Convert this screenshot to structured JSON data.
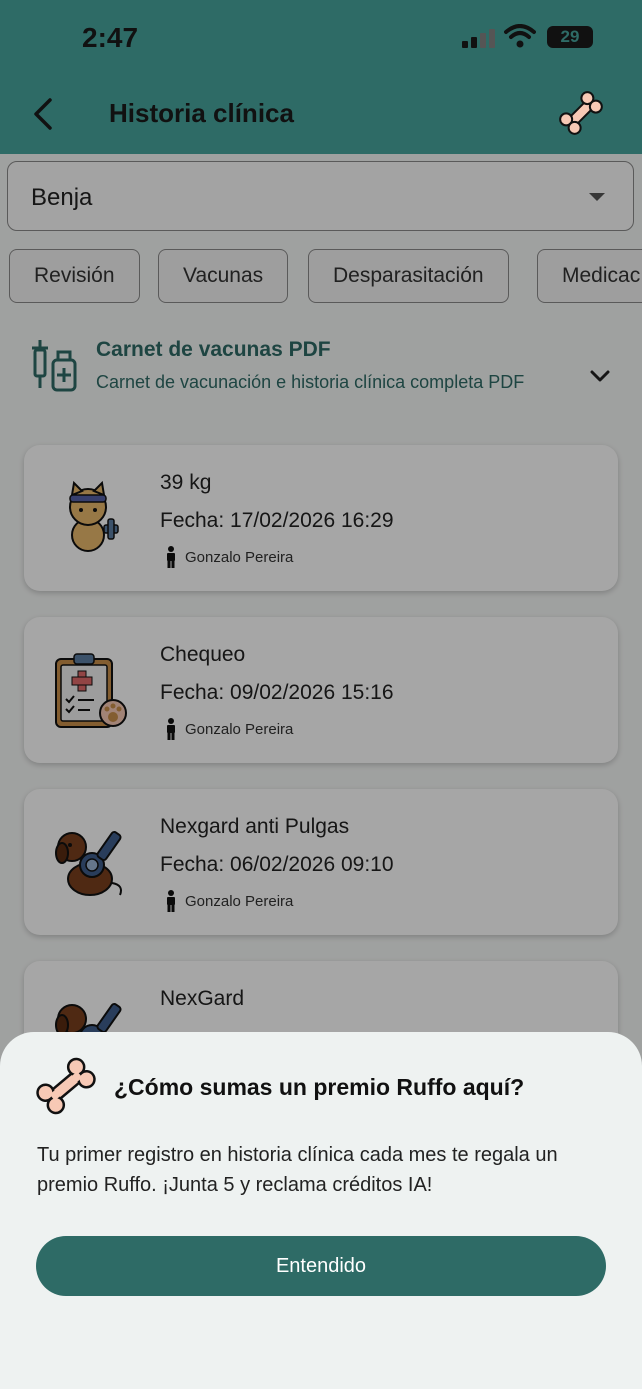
{
  "status_bar": {
    "time": "2:47",
    "battery": "29"
  },
  "app_bar": {
    "title": "Historia clínica"
  },
  "pet_selector": {
    "value": "Benja"
  },
  "filter_chips": [
    "Revisión",
    "Vacunas",
    "Desparasitación",
    "Medicac"
  ],
  "carnet": {
    "title": "Carnet de vacunas PDF",
    "subtitle": "Carnet de vacunación e historia clínica completa PDF"
  },
  "records": [
    {
      "title": "39 kg",
      "date": "Fecha: 17/02/2026 16:29",
      "author": "Gonzalo Pereira",
      "icon": "cat-weight-icon"
    },
    {
      "title": "Chequeo",
      "date": "Fecha: 09/02/2026 15:16",
      "author": "Gonzalo Pereira",
      "icon": "clipboard-checkup-icon"
    },
    {
      "title": "Nexgard anti Pulgas",
      "date": "Fecha: 06/02/2026 09:10",
      "author": "Gonzalo Pereira",
      "icon": "dog-antiparasite-icon"
    },
    {
      "title": "NexGard",
      "date": "",
      "author": "",
      "icon": "dog-antiparasite-icon"
    }
  ],
  "sheet": {
    "question": "¿Cómo sumas un premio Ruffo aquí?",
    "body": "Tu primer registro en historia clínica cada mes te regala un premio Ruffo. ¡Junta 5 y reclama créditos IA!",
    "button": "Entendido"
  },
  "colors": {
    "primary": "#2e6b66",
    "bone": "#f7c9b5"
  }
}
